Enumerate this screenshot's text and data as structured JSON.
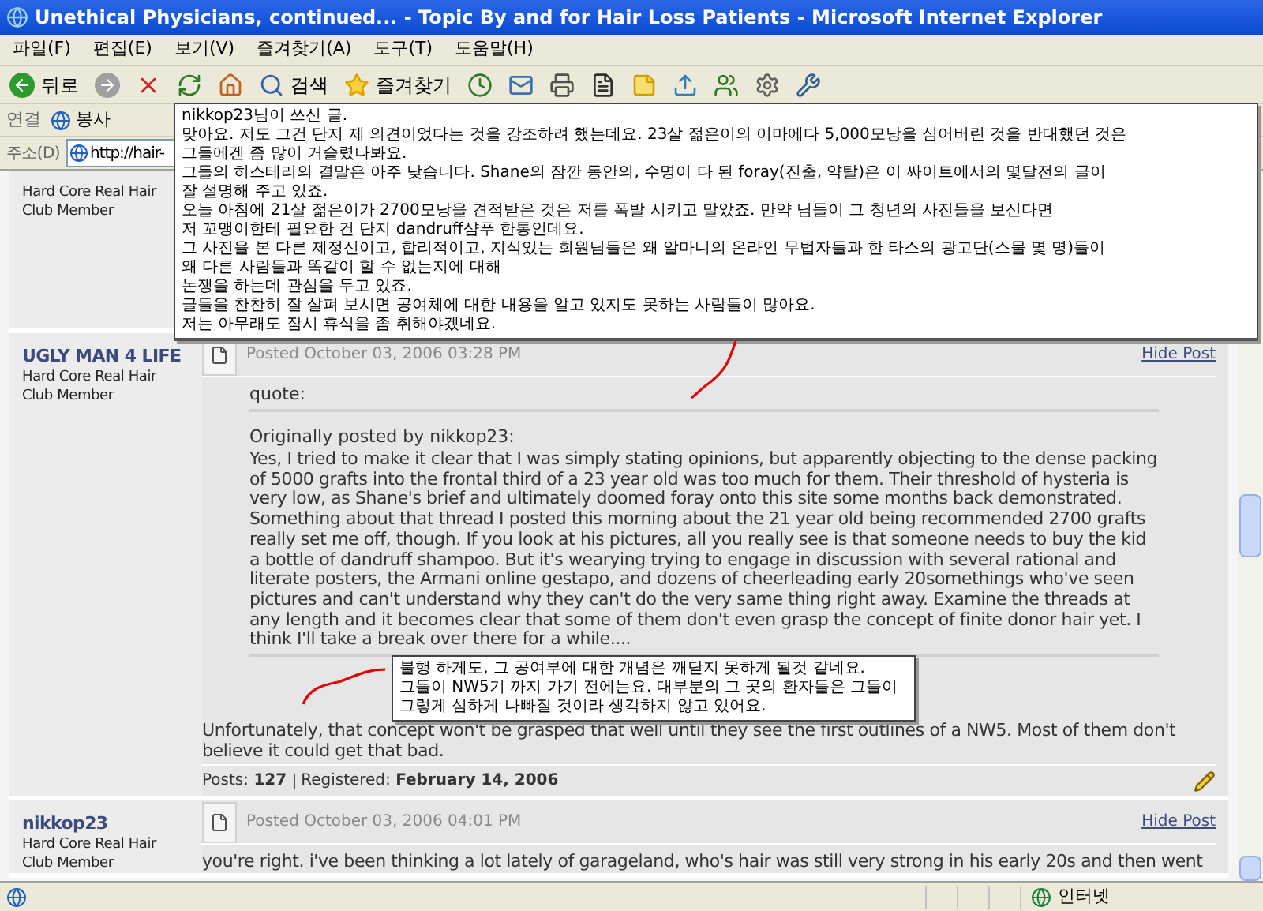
{
  "window": {
    "title": "Unethical Physicians, continued... - Topic By and for Hair Loss Patients - Microsoft Internet Explorer"
  },
  "menu": [
    "파일(F)",
    "편집(E)",
    "보기(V)",
    "즐겨찾기(A)",
    "도구(T)",
    "도움말(H)"
  ],
  "toolbar": [
    {
      "kind": "back",
      "label": "뒤로"
    },
    {
      "kind": "forward"
    },
    {
      "kind": "stop"
    },
    {
      "kind": "refresh"
    },
    {
      "kind": "home"
    },
    {
      "kind": "search",
      "label": "검색"
    },
    {
      "kind": "favorites",
      "label": "즐겨찾기"
    },
    {
      "kind": "history"
    },
    {
      "kind": "mail"
    },
    {
      "kind": "print"
    },
    {
      "kind": "edit"
    },
    {
      "kind": "note"
    },
    {
      "kind": "upload"
    },
    {
      "kind": "messenger"
    },
    {
      "kind": "settings"
    },
    {
      "kind": "tool"
    }
  ],
  "links_bar": {
    "label": "연결",
    "items": [
      "봉사"
    ]
  },
  "address_bar": {
    "label": "주소(D)",
    "value": "http://hair-"
  },
  "posts": [
    {
      "author_title": [
        "Hard Core Real Hair",
        "Club Member"
      ]
    },
    {
      "author": "UGLY MAN 4 LIFE",
      "author_title": [
        "Hard Core Real Hair",
        "Club Member"
      ],
      "posted": "Posted October 03, 2006 03:28 PM",
      "hide_link": "Hide Post",
      "quote": {
        "label": "quote:",
        "attribution": "Originally posted by nikkop23:",
        "text": "Yes, I tried to make it clear that I was simply stating opinions, but apparently objecting to the dense packing of 5000 grafts into the frontal third of a 23 year old was too much for them. Their threshold of hysteria is very low, as Shane's brief and ultimately doomed foray onto this site some months back demonstrated. Something about that thread I posted this morning about the 21 year old being recommended 2700 grafts really set me off, though. If you look at his pictures, all you really see is that someone needs to buy the kid a bottle of dandruff shampoo. But it's wearying trying to engage in discussion with several rational and literate posters, the Armani online gestapo, and dozens of cheerleading early 20somethings who've seen pictures and can't understand why they can't do the very same thing right away. Examine the threads at any length and it becomes clear that some of them don't even grasp the concept of finite donor hair yet. I think I'll take a break over there for a while...."
      },
      "body": "Unfortunately, that concept won't be grasped that well until they see the first outlines of a NW5. Most of them don't believe it could get that bad.",
      "stats": [
        {
          "label": "Posts:",
          "value": "127"
        },
        {
          "label": "Registered:",
          "value": "February 14, 2006"
        }
      ]
    },
    {
      "author": "nikkop23",
      "author_title": [
        "Hard Core Real Hair",
        "Club Member"
      ],
      "posted": "Posted October 03, 2006 04:01 PM",
      "hide_link": "Hide Post",
      "body": "you're right. i've been thinking a lot lately of garageland, who's hair was still very strong in his early 20s and then went"
    }
  ],
  "popups": [
    {
      "lines": [
        "nikkop23님이 쓰신 글.",
        "맞아요. 저도 그건 단지 제 의견이었다는 것을 강조하려 했는데요. 23살 젊은이의 이마에다 5,000모낭을 심어버린 것을 반대했던 것은",
        "그들에겐 좀 많이 거슬렸나봐요.",
        "그들의 히스테리의 결말은 아주 낮습니다. Shane의 잠깐 동안의, 수명이 다 된 foray(진출, 약탈)은 이 싸이트에서의 몇달전의 글이",
        "잘 설명해 주고 있죠.",
        "오늘 아침에 21살 젊은이가 2700모낭을 견적받은 것은 저를 폭발 시키고 말았죠. 만약 님들이 그 청년의 사진들을 보신다면",
        "저 꼬맹이한테 필요한 건 단지 dandruff샴푸 한통인데요.",
        "그 사진을 본 다른 제정신이고, 합리적이고, 지식있는 회원님들은 왜 알마니의 온라인 무법자들과 한 타스의 광고단(스물 몇 명)들이",
        "왜 다른 사람들과 똑같이 할 수 없는지에 대해",
        "논쟁을 하는데 관심을 두고 있죠.",
        "글들을 찬찬히 잘 살펴 보시면 공여체에 대한 내용을 알고 있지도 못하는 사람들이 많아요.",
        "저는 아무래도 잠시 휴식을 좀 취해야겠네요."
      ]
    },
    {
      "lines": [
        "불행 하게도, 그 공여부에 대한 개념은 깨닫지 못하게 될것 같네요.",
        "그들이 NW5기 까지 가기 전에는요. 대부분의 그 곳의 환자들은 그들이",
        "그렇게 심하게 나빠질 것이라 생각하지 않고 있어요."
      ]
    }
  ],
  "status_bar": {
    "zone": "인터넷"
  }
}
